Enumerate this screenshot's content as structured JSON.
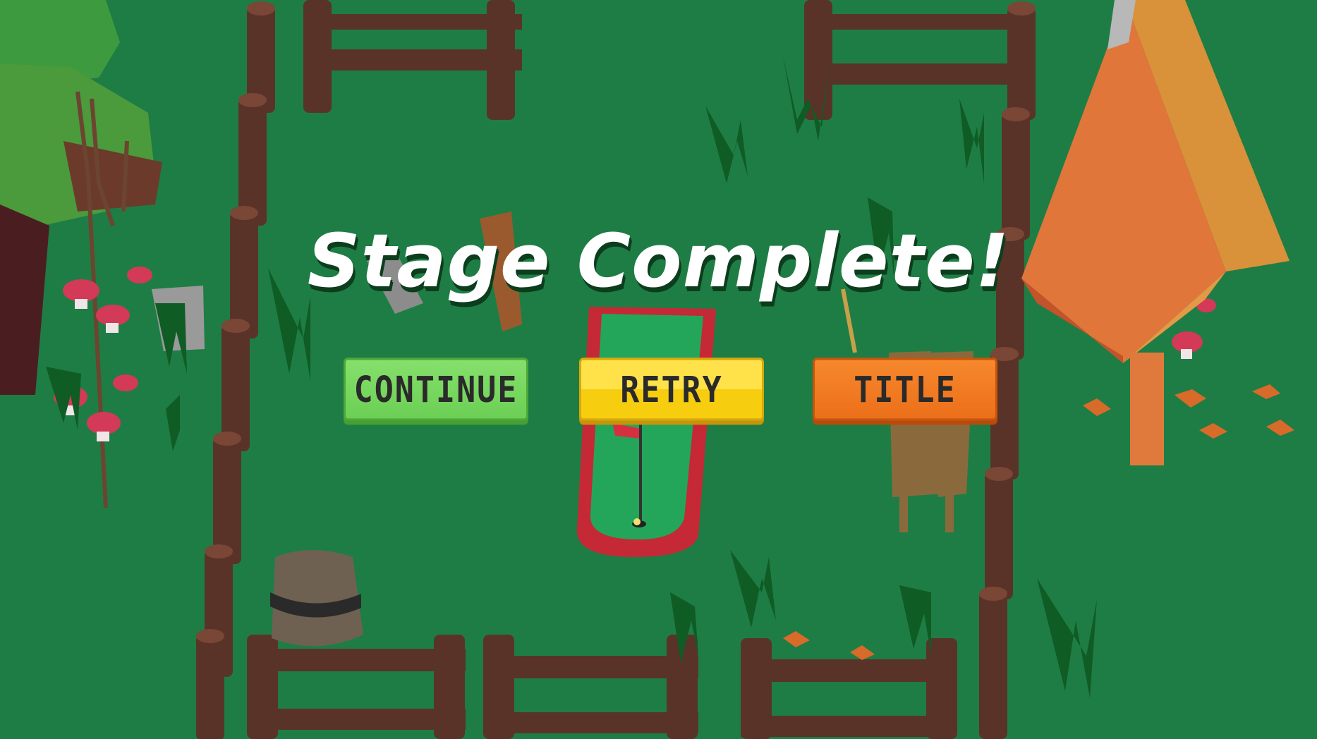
{
  "screen": {
    "heading": "Stage Complete!"
  },
  "buttons": {
    "continue_label": "CONTINUE",
    "retry_label": "RETRY",
    "title_label": "TITLE"
  },
  "colors": {
    "grass": "#1e7d45",
    "continue": "#6ccf55",
    "retry": "#f7cd10",
    "title": "#ec6f1a"
  }
}
